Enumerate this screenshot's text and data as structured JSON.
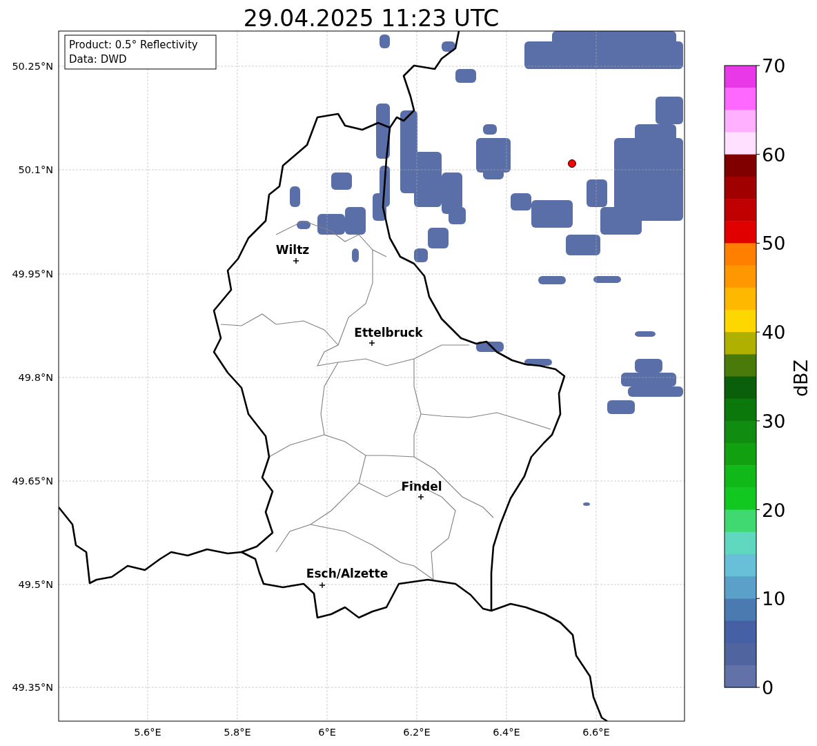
{
  "title": "29.04.2025 11:23 UTC",
  "info_box": {
    "lines": [
      "Product: 0.5° Reflectivity",
      "Data: DWD"
    ]
  },
  "map": {
    "yticks": [
      "50.25°N",
      "50.1°N",
      "49.95°N",
      "49.8°N",
      "49.65°N",
      "49.5°N",
      "49.35°N"
    ],
    "xticks": [
      "5.6°E",
      "5.8°E",
      "6°E",
      "6.2°E",
      "6.4°E",
      "6.6°E"
    ],
    "cities": [
      {
        "name": "Wiltz"
      },
      {
        "name": "Ettelbruck"
      },
      {
        "name": "Findel"
      },
      {
        "name": "Esch/Alzette"
      }
    ]
  },
  "colorbar": {
    "label": "dBZ",
    "ticks": [
      "70",
      "60",
      "50",
      "40",
      "30",
      "20",
      "10",
      "0"
    ],
    "bands": [
      {
        "color": "#e838e8"
      },
      {
        "color": "#ff68ff"
      },
      {
        "color": "#ffb0ff"
      },
      {
        "color": "#ffe0ff"
      },
      {
        "color": "#800000"
      },
      {
        "color": "#a00000"
      },
      {
        "color": "#c00000"
      },
      {
        "color": "#e00000"
      },
      {
        "color": "#ff7f00"
      },
      {
        "color": "#ff9800"
      },
      {
        "color": "#ffb800"
      },
      {
        "color": "#ffd700"
      },
      {
        "color": "#b0b000"
      },
      {
        "color": "#4a7a0a"
      },
      {
        "color": "#0a600a"
      },
      {
        "color": "#0a780a"
      },
      {
        "color": "#108c10"
      },
      {
        "color": "#10a010"
      },
      {
        "color": "#10b818"
      },
      {
        "color": "#10c820"
      },
      {
        "color": "#40d870"
      },
      {
        "color": "#60d8c0"
      },
      {
        "color": "#68c0d8"
      },
      {
        "color": "#5aa0c8"
      },
      {
        "color": "#4a7ab0"
      },
      {
        "color": "#4560a5"
      },
      {
        "color": "#5064a0"
      },
      {
        "color": "#6272a8"
      }
    ]
  }
}
